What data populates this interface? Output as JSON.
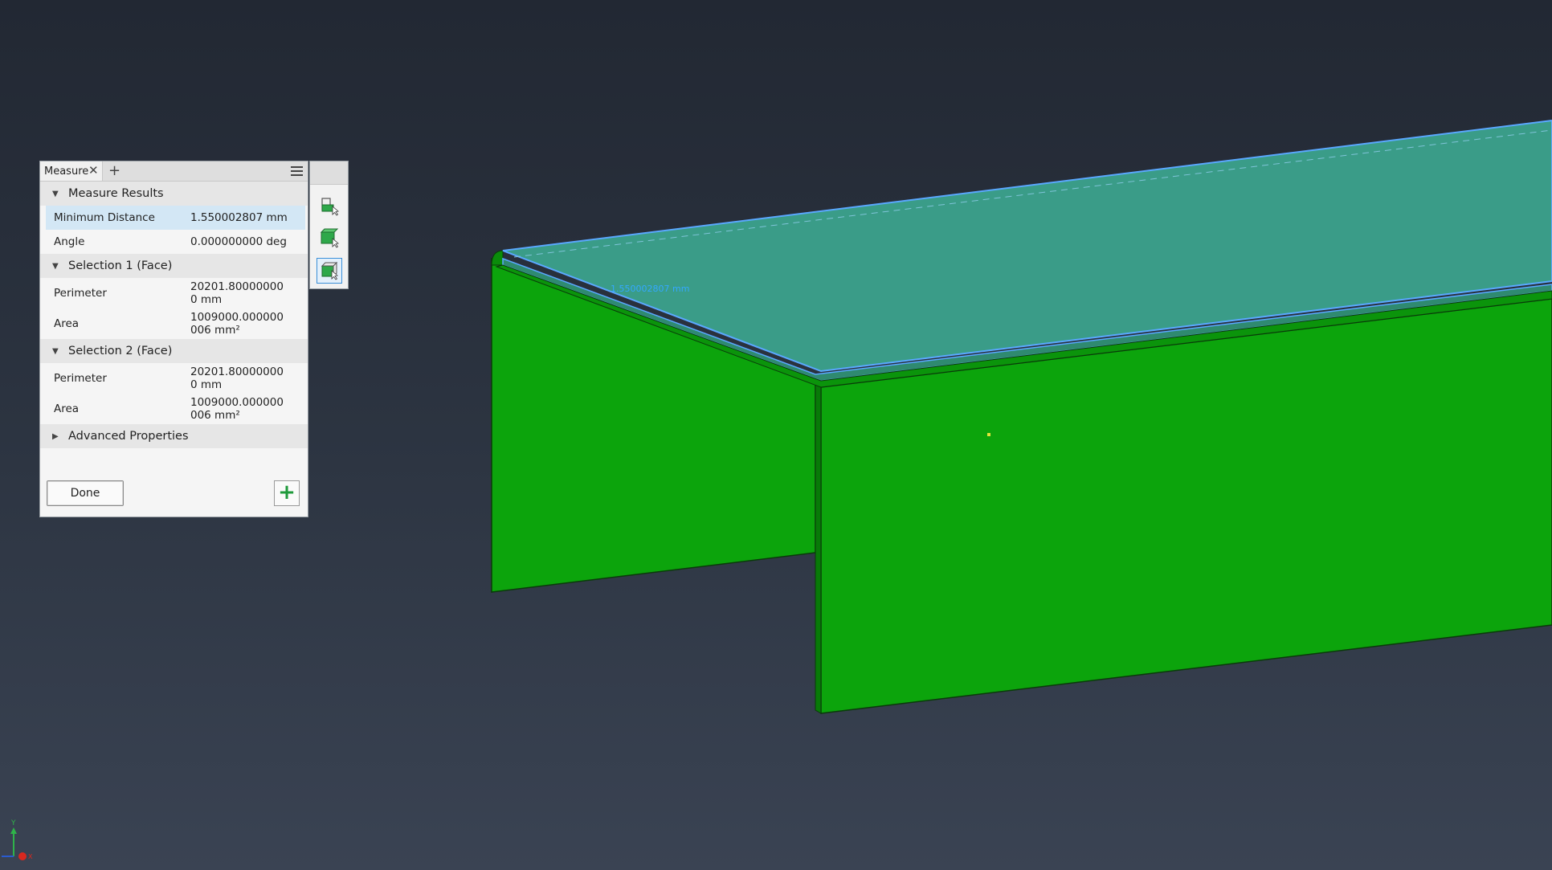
{
  "panel": {
    "tab_label": "Measure",
    "close_glyph": "✕",
    "add_tab_glyph": "+"
  },
  "results": {
    "header": "Measure Results",
    "rows": [
      {
        "label": "Minimum Distance",
        "value": "1.550002807 mm"
      },
      {
        "label": "Angle",
        "value": "0.000000000 deg"
      }
    ]
  },
  "selection1": {
    "header": "Selection 1 (Face)",
    "perimeter_label": "Perimeter",
    "perimeter_value": "20201.80000000\n0 mm",
    "area_label": "Area",
    "area_value": "1009000.000000\n006 mm²"
  },
  "selection2": {
    "header": "Selection 2 (Face)",
    "perimeter_label": "Perimeter",
    "perimeter_value": "20201.80000000\n0 mm",
    "area_label": "Area",
    "area_value": "1009000.000000\n006 mm²"
  },
  "advanced": {
    "header": "Advanced Properties"
  },
  "footer": {
    "done_label": "Done",
    "add_glyph": "+"
  },
  "viewport": {
    "dimension_label": "1.550002807 mm",
    "triad_y": "Y",
    "triad_x": "X"
  },
  "colors": {
    "part_green": "#0ca40c",
    "selection_face": "#3a9c88",
    "highlight_edge": "#5aa8ff",
    "panel_bg": "#f5f5f5",
    "accent_blue": "#3a8fd8",
    "add_green": "#1f9a3b"
  },
  "icons": [
    "close-icon",
    "plus-icon",
    "hamburger-menu-icon",
    "collapse-triangle-icon",
    "expand-triangle-icon",
    "select-component-icon",
    "select-part-icon",
    "select-face-icon",
    "view-triad-icon"
  ]
}
